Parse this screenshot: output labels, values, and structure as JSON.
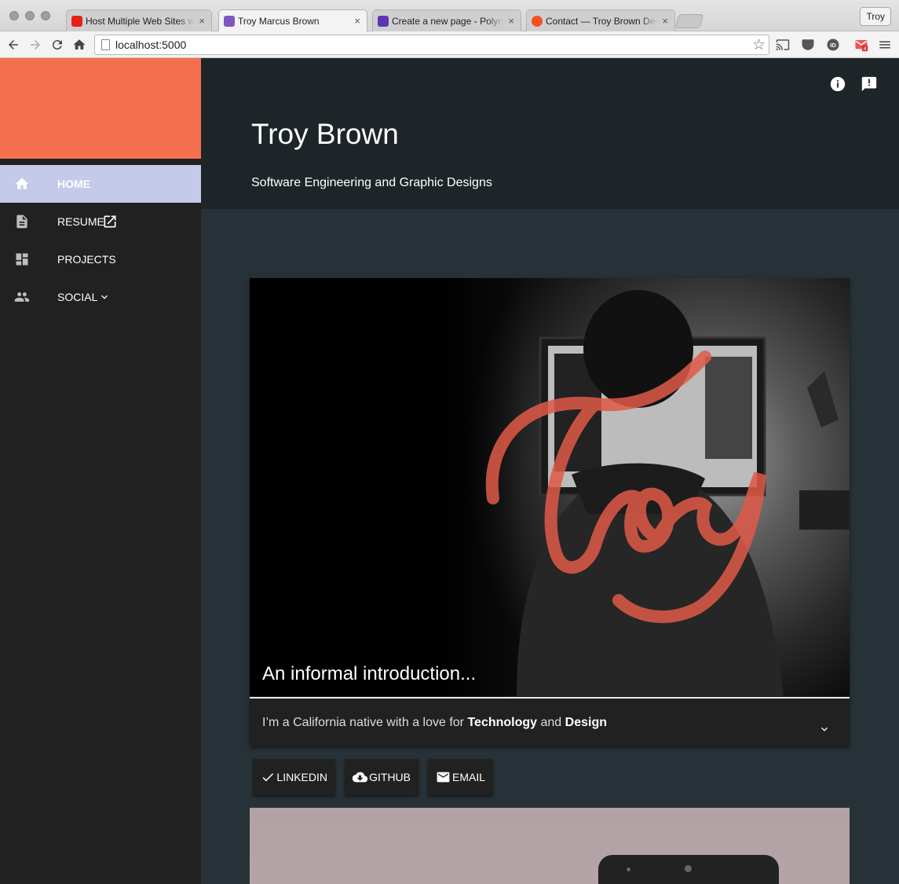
{
  "browser": {
    "tabs": [
      {
        "title": "Host Multiple Web Sites with",
        "favicon": "youtube-favicon",
        "color": "#e62117"
      },
      {
        "title": "Troy Marcus Brown",
        "favicon": "polymer-favicon",
        "color": "#7e57c2"
      },
      {
        "title": "Create a new page - Polymer",
        "favicon": "polymer-favicon",
        "color": "#5e35b1"
      },
      {
        "title": "Contact — Troy Brown Design",
        "favicon": "site-favicon",
        "color": "#f4511e"
      }
    ],
    "active_tab_index": 1,
    "profile_name": "Troy",
    "url": "localhost:5000",
    "extension_badge": "4"
  },
  "drawer": {
    "banner_color": "#f4704f",
    "items": [
      {
        "label": "HOME",
        "icon": "home-icon",
        "active": true
      },
      {
        "label": "RESUME",
        "icon": "description-icon",
        "active": false,
        "trailing_icon": "open-in-new-icon"
      },
      {
        "label": "PROJECTS",
        "icon": "dashboard-icon",
        "active": false
      },
      {
        "label": "SOCIAL",
        "icon": "people-icon",
        "active": false,
        "trailing_icon": "chevron-down-icon"
      }
    ]
  },
  "header": {
    "title": "Troy Brown",
    "subtitle": "Software Engineering and Graphic Designs",
    "icons": [
      "info-icon",
      "feedback-icon"
    ]
  },
  "intro_card": {
    "caption": "An informal introduction...",
    "body_prefix": "I’m a California native with a love for ",
    "body_bold_1": "Technology",
    "body_middle": " and ",
    "body_bold_2": "Design",
    "image_lettering": "Troy",
    "lettering_color": "#e05a48"
  },
  "actions": [
    {
      "label": "LINKEDIN",
      "icon": "check-icon"
    },
    {
      "label": "GITHUB",
      "icon": "cloud-download-icon"
    },
    {
      "label": "EMAIL",
      "icon": "email-icon"
    }
  ],
  "colors": {
    "accent": "#f4704f",
    "nav_active": "#c5cae9",
    "page_bg": "#263238",
    "header_bg": "#1e2529",
    "drawer_bg": "#212121"
  }
}
